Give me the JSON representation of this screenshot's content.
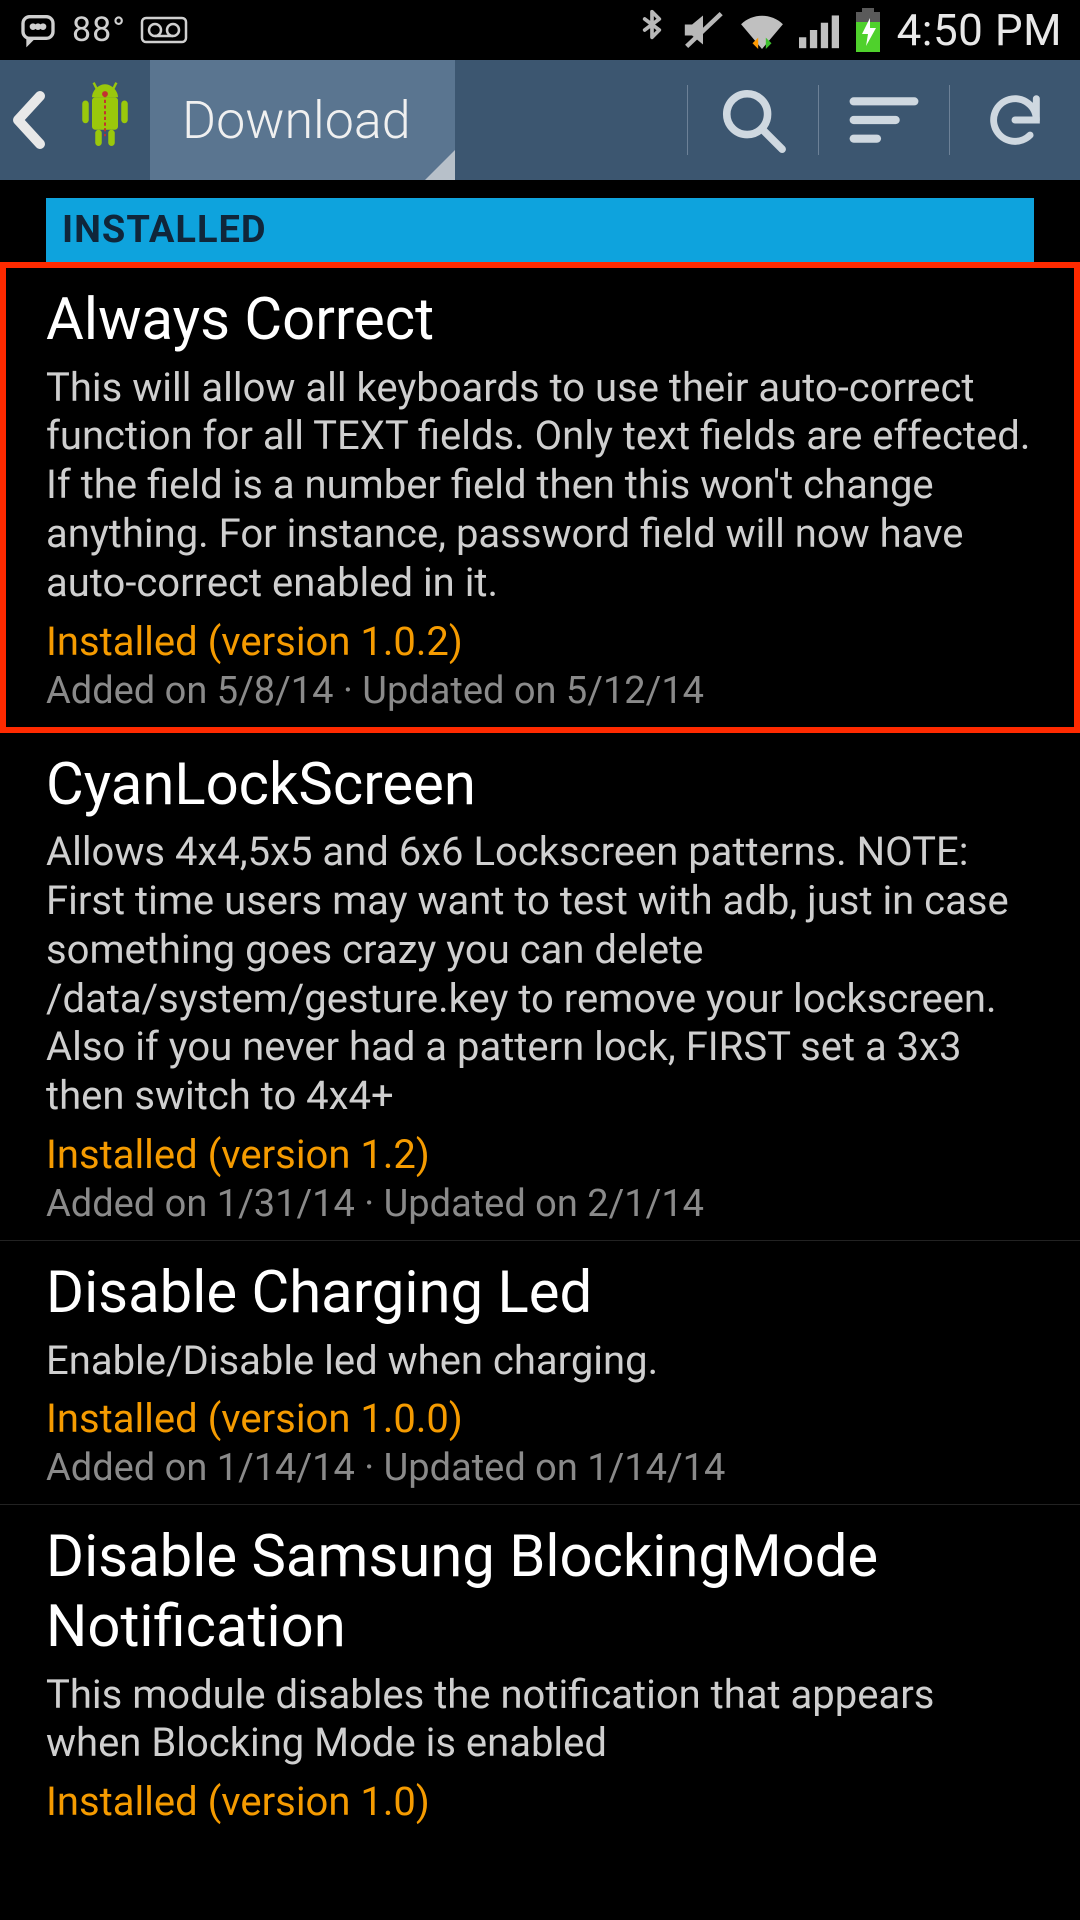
{
  "status": {
    "temperature": "88°",
    "time": "4:50 PM"
  },
  "actionbar": {
    "tab_label": "Download"
  },
  "section_header": "INSTALLED",
  "colors": {
    "actionbar_bg": "#3c5670",
    "tab_bg": "#5a7590",
    "section_bg": "#0ea3dd",
    "installed_text": "#f59b00",
    "highlight_border": "#ff2a00"
  },
  "modules": [
    {
      "title": "Always Correct",
      "description": "This will allow all keyboards to use their auto-correct function for all TEXT fields. Only text fields are effected. If the field is a number field then this won't change anything. For instance, password field will now have auto-correct enabled in it.",
      "installed": "Installed (version 1.0.2)",
      "dates": "Added on 5/8/14 · Updated on 5/12/14",
      "highlighted": true
    },
    {
      "title": "CyanLockScreen",
      "description": "Allows 4x4,5x5 and 6x6 Lockscreen patterns. NOTE: First time users may want to test with adb, just in case something goes crazy you can delete /data/system/gesture.key to remove your lockscreen. Also if you never had a pattern lock, FIRST set a 3x3 then switch to 4x4+",
      "installed": "Installed (version 1.2)",
      "dates": "Added on 1/31/14 · Updated on 2/1/14",
      "highlighted": false
    },
    {
      "title": "Disable Charging Led",
      "description": "Enable/Disable led when charging.",
      "installed": "Installed (version 1.0.0)",
      "dates": "Added on 1/14/14 · Updated on 1/14/14",
      "highlighted": false
    },
    {
      "title": "Disable Samsung BlockingMode Notification",
      "description": "This module disables the notification that appears when Blocking Mode is enabled",
      "installed": "Installed (version 1.0)",
      "dates": "",
      "highlighted": false
    }
  ]
}
